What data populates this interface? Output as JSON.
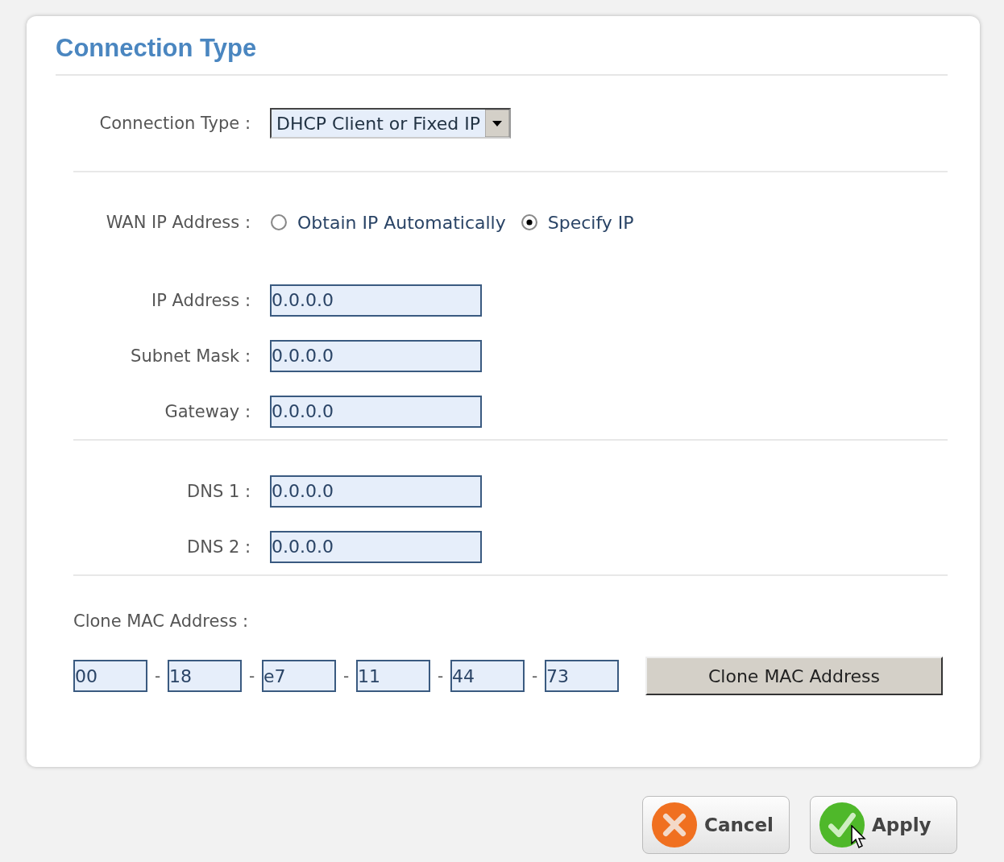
{
  "title": "Connection Type",
  "connection_type": {
    "label": "Connection Type :",
    "value": "DHCP Client or Fixed IP"
  },
  "wan_ip": {
    "label": "WAN IP Address :",
    "options": [
      {
        "label": "Obtain IP Automatically",
        "selected": false
      },
      {
        "label": "Specify IP",
        "selected": true
      }
    ]
  },
  "ip_fields": [
    {
      "label": "IP Address :",
      "value": "0.0.0.0"
    },
    {
      "label": "Subnet Mask :",
      "value": "0.0.0.0"
    },
    {
      "label": "Gateway :",
      "value": "0.0.0.0"
    }
  ],
  "dns_fields": [
    {
      "label": "DNS 1 :",
      "value": "0.0.0.0"
    },
    {
      "label": "DNS 2 :",
      "value": "0.0.0.0"
    }
  ],
  "clone_mac": {
    "label": "Clone MAC Address :",
    "octets": [
      "00",
      "18",
      "e7",
      "11",
      "44",
      "73"
    ],
    "separator": "-",
    "button": "Clone MAC Address"
  },
  "buttons": [
    {
      "label": "Cancel",
      "kind": "cancel"
    },
    {
      "label": "Apply",
      "kind": "apply"
    }
  ]
}
